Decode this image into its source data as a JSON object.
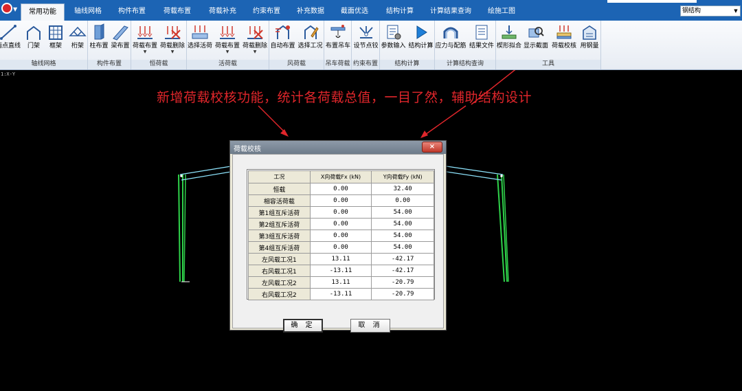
{
  "tabs": [
    "常用功能",
    "轴线网格",
    "构件布置",
    "荷载布置",
    "荷载补充",
    "约束布置",
    "补充数据",
    "截面优选",
    "结构计算",
    "计算结果查询",
    "绘施工图"
  ],
  "active_tab": 0,
  "structure_type": "钢结构",
  "ribbon_groups": [
    {
      "label": "轴线网格",
      "buttons": [
        {
          "label": "两点直线",
          "icon": "line-icon"
        },
        {
          "label": "门架",
          "icon": "portal-frame-icon"
        },
        {
          "label": "框架",
          "icon": "frame-grid-icon"
        },
        {
          "label": "桁架",
          "icon": "truss-icon"
        }
      ]
    },
    {
      "label": "构件布置",
      "buttons": [
        {
          "label": "柱布置",
          "icon": "column-icon"
        },
        {
          "label": "梁布置",
          "icon": "beam-icon"
        }
      ]
    },
    {
      "label": "恒荷载",
      "buttons": [
        {
          "label": "荷载布置",
          "icon": "load-arrows-icon",
          "dropdown": true
        },
        {
          "label": "荷载删除",
          "icon": "load-delete-icon",
          "dropdown": true
        }
      ]
    },
    {
      "label": "活荷载",
      "buttons": [
        {
          "label": "选择活荷",
          "icon": "select-live-load-icon"
        },
        {
          "label": "荷载布置",
          "icon": "load-arrows-icon",
          "dropdown": true
        },
        {
          "label": "荷载删除",
          "icon": "load-delete-icon",
          "dropdown": true
        }
      ]
    },
    {
      "label": "风荷载",
      "buttons": [
        {
          "label": "自动布置",
          "icon": "wind-auto-icon"
        },
        {
          "label": "选择工况",
          "icon": "wind-case-icon"
        }
      ]
    },
    {
      "label": "吊车荷载",
      "buttons": [
        {
          "label": "布置吊车",
          "icon": "crane-icon"
        }
      ]
    },
    {
      "label": "约束布置",
      "buttons": [
        {
          "label": "设节点铰",
          "icon": "hinge-icon"
        }
      ]
    },
    {
      "label": "结构计算",
      "buttons": [
        {
          "label": "参数输入",
          "icon": "parameters-icon"
        },
        {
          "label": "结构计算",
          "icon": "run-calculation-icon"
        }
      ]
    },
    {
      "label": "计算结构查询",
      "buttons": [
        {
          "label": "应力与配筋",
          "icon": "stress-icon"
        },
        {
          "label": "结果文件",
          "icon": "result-file-icon"
        }
      ]
    },
    {
      "label": "工具",
      "buttons": [
        {
          "label": "楔形拟合",
          "icon": "wedge-fit-icon"
        },
        {
          "label": "显示截面",
          "icon": "show-section-icon"
        },
        {
          "label": "荷载校核",
          "icon": "load-check-icon"
        },
        {
          "label": "用钢量",
          "icon": "steel-usage-icon"
        }
      ]
    }
  ],
  "viewport": {
    "tag": "1:X-Y"
  },
  "annotation": "新增荷载校核功能，统计各荷载总值，一目了然，辅助结构设计",
  "dialog": {
    "title": "荷载校核",
    "close_label": "×",
    "columns": [
      "工况",
      "X向荷载Fx (kN)",
      "Y向荷载Fy (kN)"
    ],
    "rows": [
      {
        "case": "恒载",
        "fx": "0.00",
        "fy": "32.40"
      },
      {
        "case": "相容活荷载",
        "fx": "0.00",
        "fy": "0.00"
      },
      {
        "case": "第1组互斥活荷",
        "fx": "0.00",
        "fy": "54.00"
      },
      {
        "case": "第2组互斥活荷",
        "fx": "0.00",
        "fy": "54.00"
      },
      {
        "case": "第3组互斥活荷",
        "fx": "0.00",
        "fy": "54.00"
      },
      {
        "case": "第4组互斥活荷",
        "fx": "0.00",
        "fy": "54.00"
      },
      {
        "case": "左风载工况1",
        "fx": "13.11",
        "fy": "-42.17"
      },
      {
        "case": "右风载工况1",
        "fx": "-13.11",
        "fy": "-42.17"
      },
      {
        "case": "左风载工况2",
        "fx": "13.11",
        "fy": "-20.79"
      },
      {
        "case": "右风载工况2",
        "fx": "-13.11",
        "fy": "-20.79"
      }
    ],
    "ok_label": "确 定",
    "cancel_label": "取 消"
  }
}
